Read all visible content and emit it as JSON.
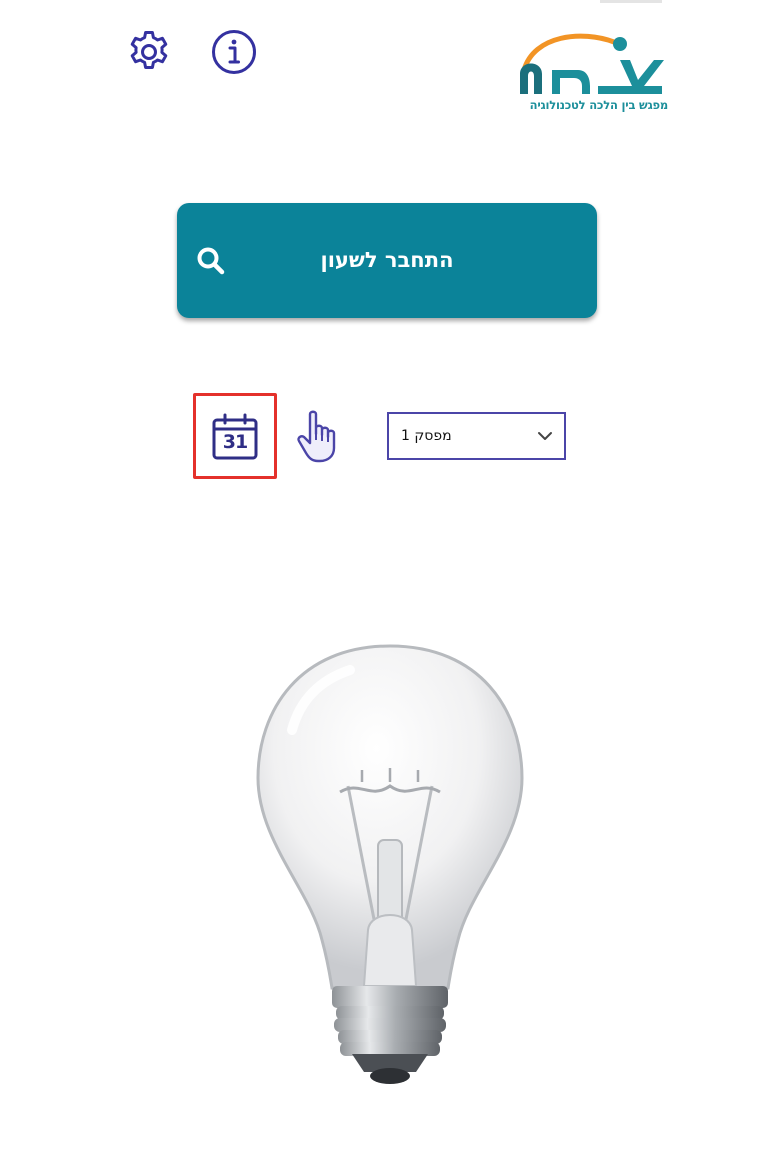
{
  "header": {
    "settings_icon": "gear-icon",
    "info_icon": "info-icon",
    "logo": {
      "name": "צמת",
      "tagline": "מפגש בין הלכה לטכנולוגיה",
      "colors": [
        "#1c8f9b",
        "#f29425",
        "#1b6f7c"
      ]
    }
  },
  "main": {
    "connect_button_label": "התחבר לשעון",
    "search_icon": "search-icon",
    "calendar_icon": "calendar-icon",
    "calendar_day": "31",
    "hand_icon": "pointing-hand-icon",
    "select": {
      "value": "מפסק 1",
      "icon": "chevron-down-icon"
    },
    "bulb_image": "light-bulb"
  },
  "colors": {
    "primary": "#0b8399",
    "accent_purple": "#2f2e86",
    "highlight": "#e4312b"
  }
}
